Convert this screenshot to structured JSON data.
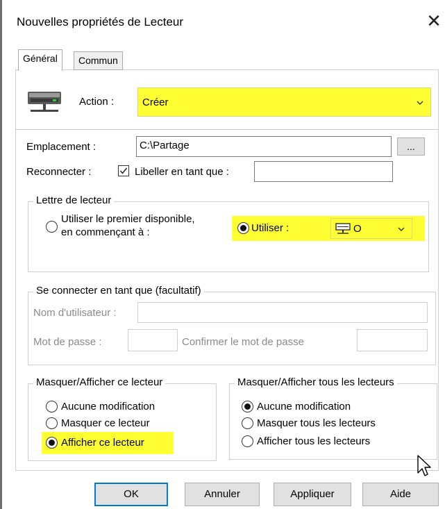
{
  "window": {
    "title": "Nouvelles propriétés de Lecteur",
    "close": "✕"
  },
  "tabs": [
    {
      "label": "Général",
      "active": true
    },
    {
      "label": "Commun",
      "active": false
    }
  ],
  "action": {
    "label": "Action :",
    "value": "Créer"
  },
  "location": {
    "label": "Emplacement :",
    "value": "C:\\Partage",
    "browse_label": "..."
  },
  "reconnect": {
    "label": "Reconnecter :",
    "checked": true,
    "label_as": "Libeller en tant que :",
    "label_as_value": ""
  },
  "drive_letter": {
    "group_title": "Lettre de lecteur",
    "first_available_line1": "Utiliser le premier disponible,",
    "first_available_line2": "en commençant à :",
    "use_label": "Utiliser :",
    "use_value": "O",
    "selected": "use"
  },
  "connect_as": {
    "group_title": "Se connecter en tant que (facultatif)",
    "username_label": "Nom d'utilisateur :",
    "password_label": "Mot de passe :",
    "confirm_label": "Confirmer le mot de passe"
  },
  "hide_show_this": {
    "group_title": "Masquer/Afficher ce lecteur",
    "options": [
      "Aucune modification",
      "Masquer ce lecteur",
      "Afficher ce lecteur"
    ],
    "selected_index": 2
  },
  "hide_show_all": {
    "group_title": "Masquer/Afficher tous les lecteurs",
    "options": [
      "Aucune modification",
      "Masquer tous les lecteurs",
      "Afficher tous les lecteurs"
    ],
    "selected_index": 0
  },
  "buttons": {
    "ok": "OK",
    "cancel": "Annuler",
    "apply": "Appliquer",
    "help": "Aide"
  },
  "colors": {
    "highlight": "#ffff33",
    "default_button_border": "#0078d7"
  },
  "icons": {
    "drive": "network-drive-icon",
    "drive_small": "network-drive-small-icon",
    "chevron": "chevron-down-icon",
    "cursor": "mouse-cursor-icon"
  }
}
